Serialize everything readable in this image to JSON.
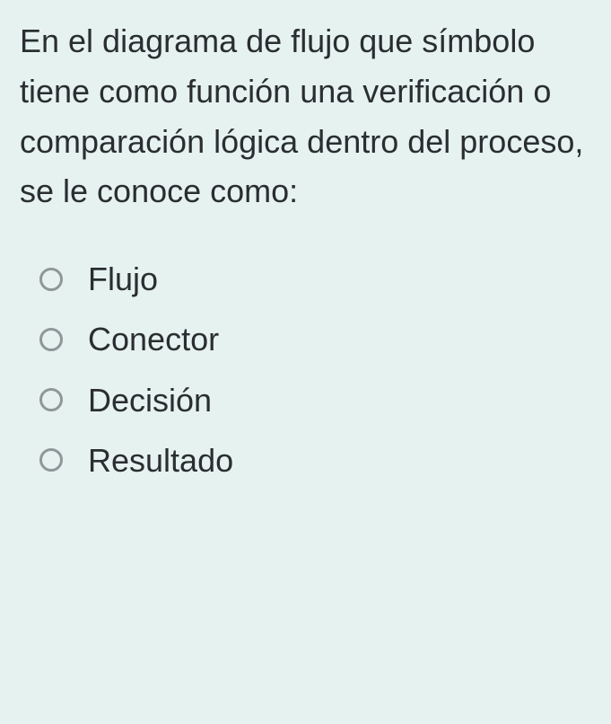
{
  "question": "En el diagrama de flujo que símbolo tiene como función una verificación o comparación lógica dentro del proceso, se le conoce como:",
  "options": [
    {
      "label": "Flujo"
    },
    {
      "label": "Conector"
    },
    {
      "label": "Decisión"
    },
    {
      "label": "Resultado"
    }
  ]
}
